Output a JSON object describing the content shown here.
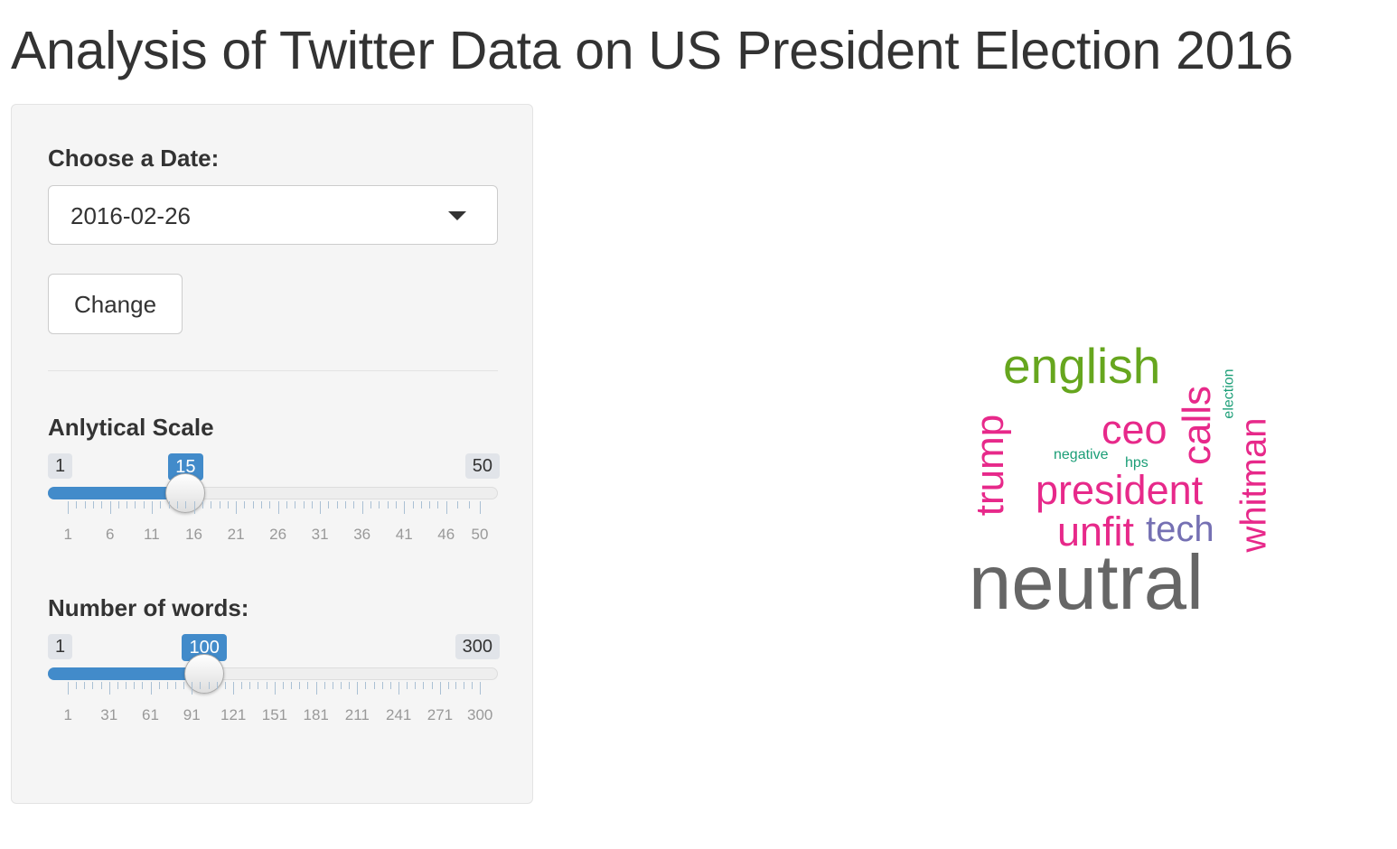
{
  "page": {
    "title": "Analysis of Twitter Data on US President Election 2016"
  },
  "sidebar": {
    "date_label": "Choose a Date:",
    "date_value": "2016-02-26",
    "change_button": "Change",
    "scale_slider": {
      "label": "Anlytical Scale",
      "min": 1,
      "max": 50,
      "value": 15,
      "min_label": "1",
      "max_label": "50",
      "value_label": "15",
      "tick_labels": [
        "1",
        "6",
        "11",
        "16",
        "21",
        "26",
        "31",
        "36",
        "41",
        "46",
        "50"
      ]
    },
    "words_slider": {
      "label": "Number of words:",
      "min": 1,
      "max": 300,
      "value": 100,
      "min_label": "1",
      "max_label": "300",
      "value_label": "100",
      "tick_labels": [
        "1",
        "31",
        "61",
        "91",
        "121",
        "151",
        "181",
        "211",
        "241",
        "271",
        "300"
      ]
    }
  },
  "colors": {
    "accent": "#428bca",
    "gray": "#666666",
    "green": "#66a61e",
    "pink": "#e7298a",
    "purple": "#7570b3",
    "teal": "#1b9e77"
  },
  "wordcloud": {
    "words": [
      {
        "text": "neutral",
        "color": "#666666"
      },
      {
        "text": "english",
        "color": "#66a61e"
      },
      {
        "text": "president",
        "color": "#e7298a"
      },
      {
        "text": "unfit",
        "color": "#e7298a"
      },
      {
        "text": "ceo",
        "color": "#e7298a"
      },
      {
        "text": "calls",
        "color": "#e7298a"
      },
      {
        "text": "trump",
        "color": "#e7298a"
      },
      {
        "text": "whitman",
        "color": "#e7298a"
      },
      {
        "text": "tech",
        "color": "#7570b3"
      },
      {
        "text": "negative",
        "color": "#1b9e77"
      },
      {
        "text": "hps",
        "color": "#1b9e77"
      },
      {
        "text": "election",
        "color": "#1b9e77"
      }
    ]
  }
}
